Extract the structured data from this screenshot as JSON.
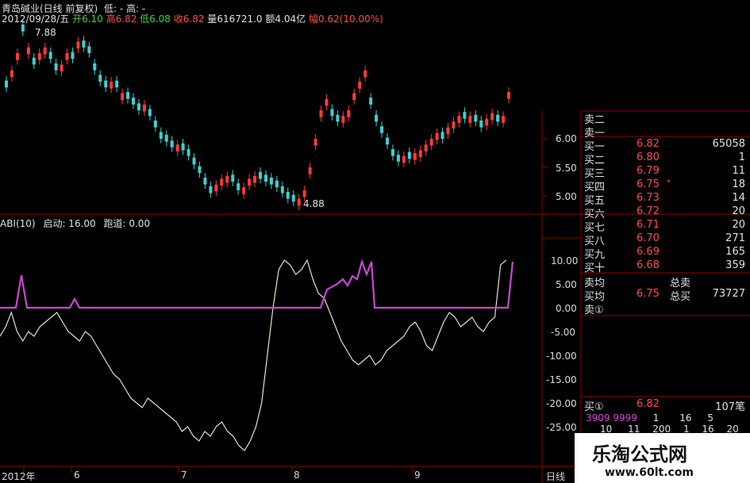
{
  "header": {
    "title": "青岛碱业(日线 前复权)",
    "date": "2012/09/28/五",
    "open_label": "开",
    "open": "6.10",
    "high_label": "高",
    "high": "6.82",
    "low_label": "低",
    "low": "6.08",
    "close_label": "收",
    "close": "6.82",
    "volume_label": "量",
    "volume": "616721.0",
    "amount_label": "额",
    "amount": "4.04亿",
    "change_label": "幅",
    "change": "0.62(10.00%)",
    "extra": "低: -  高: -"
  },
  "indicator": {
    "name": "ABI(10)",
    "start_label": "启动: 16.00",
    "runway_label": "跑道: 0.00"
  },
  "price_axis": [
    "6.00",
    "5.50",
    "5.00"
  ],
  "ind_axis": [
    "10.00",
    "5.00",
    "0.00",
    "-5.00",
    "-10.00",
    "-15.00",
    "-20.00",
    "-25.00"
  ],
  "x_axis": {
    "ticks": [
      "2012年",
      "6",
      "7",
      "8",
      "9"
    ],
    "period": "日线"
  },
  "annotations": {
    "peak": "7.88",
    "trough": "4.88"
  },
  "colors": {
    "up": "#ff3b3b",
    "down": "#3fd0d0",
    "line": "#e8e4c0",
    "purple": "#c848d0",
    "grid": "#8b0000"
  },
  "orderbook": {
    "asks": [
      {
        "label": "卖二",
        "price": "",
        "vol": ""
      },
      {
        "label": "卖一",
        "price": "",
        "vol": ""
      }
    ],
    "bids": [
      {
        "label": "买一",
        "price": "6.82",
        "vol": "65058"
      },
      {
        "label": "买二",
        "price": "6.80",
        "vol": "1"
      },
      {
        "label": "买三",
        "price": "6.79",
        "vol": "11"
      },
      {
        "label": "买四",
        "price": "6.75",
        "vol": "18",
        "marker": "*"
      },
      {
        "label": "买五",
        "price": "6.73",
        "vol": "14"
      },
      {
        "label": "买六",
        "price": "6.72",
        "vol": "20"
      },
      {
        "label": "买七",
        "price": "6.71",
        "vol": "20"
      },
      {
        "label": "买八",
        "price": "6.70",
        "vol": "271"
      },
      {
        "label": "买九",
        "price": "6.69",
        "vol": "165"
      },
      {
        "label": "买十",
        "price": "6.68",
        "vol": "359"
      }
    ],
    "avg_sell_label": "卖均",
    "total_sell_label": "总卖",
    "avg_buy_label": "买均",
    "avg_buy": "6.75",
    "total_buy_label": "总买",
    "total_buy": "73727",
    "sell_one_label": "卖①",
    "buy_one_label": "买①",
    "buy_one_price": "6.82",
    "buy_one_count": "107笔",
    "queue_1": "3909 9999",
    "queue_1_rest": [
      "1",
      "16",
      "5"
    ],
    "queue_2": [
      "10",
      "11",
      "200",
      "1",
      "16",
      "20"
    ]
  },
  "watermark": {
    "title": "乐淘公式网",
    "site": "www.60lt.com"
  }
}
